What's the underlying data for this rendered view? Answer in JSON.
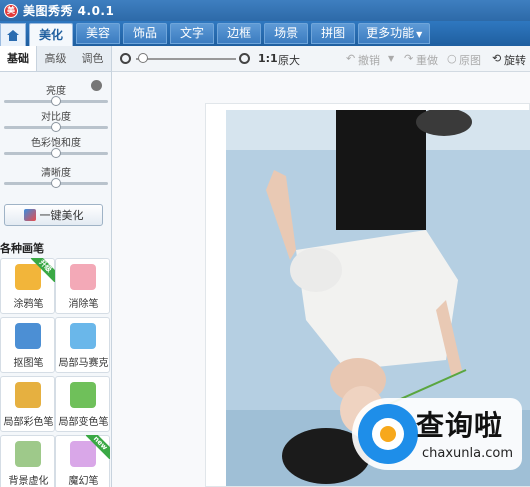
{
  "app": {
    "title": "美图秀秀 4.0.1"
  },
  "nav": {
    "tabs": [
      "美化",
      "美容",
      "饰品",
      "文字",
      "边框",
      "场景",
      "拼图"
    ],
    "more": "更多功能"
  },
  "left": {
    "subtabs": [
      "基础",
      "高级",
      "调色"
    ],
    "sliders": [
      {
        "label": "亮度",
        "value": 0.5
      },
      {
        "label": "对比度",
        "value": 0.5
      },
      {
        "label": "色彩饱和度",
        "value": 0.5
      },
      {
        "label": "清晰度",
        "value": 0.5
      }
    ],
    "one_click": "一键美化",
    "brush_title": "各种画笔",
    "tools": [
      {
        "label": "涂鸦笔",
        "badge": "升级",
        "color": "#f2b53a"
      },
      {
        "label": "消除笔",
        "badge": "",
        "color": "#f3a9b7"
      },
      {
        "label": "抠图笔",
        "badge": "",
        "color": "#4c8fd4"
      },
      {
        "label": "局部马赛克",
        "badge": "",
        "color": "#6ab7ea"
      },
      {
        "label": "局部彩色笔",
        "badge": "",
        "color": "#e6b040"
      },
      {
        "label": "局部变色笔",
        "badge": "",
        "color": "#6fc05a"
      },
      {
        "label": "背景虚化",
        "badge": "",
        "color": "#9ec98a"
      },
      {
        "label": "魔幻笔",
        "badge": "new",
        "color": "#d9a7e8"
      }
    ]
  },
  "toolbar": {
    "ratio": "1:1",
    "original": "原大",
    "undo": "撤销",
    "redo": "重做",
    "original_image": "原图",
    "rotate": "旋转"
  },
  "watermark": {
    "title": "查询啦",
    "url": "chaxunla.com"
  }
}
